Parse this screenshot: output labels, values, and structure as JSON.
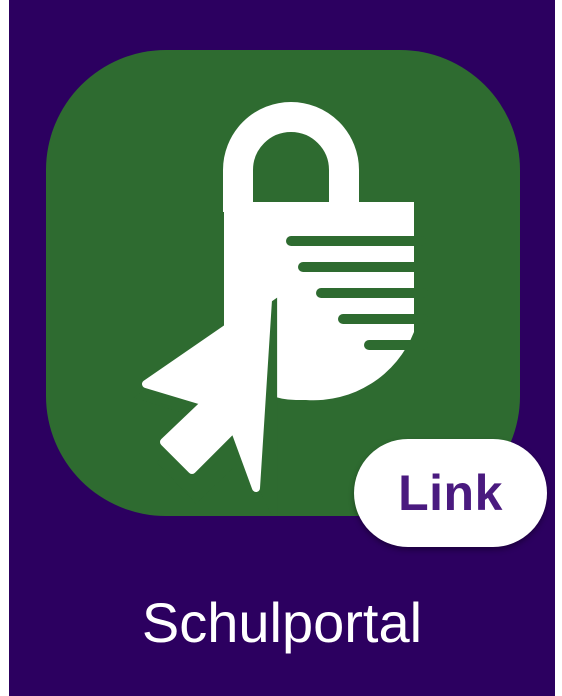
{
  "app": {
    "name": "Schulportal",
    "badge": "Link",
    "icon": "lock-pointer-icon"
  },
  "colors": {
    "background": "#2c0060",
    "tile": "#2e6b30",
    "badge_bg": "#ffffff",
    "badge_text": "#4a1a7f",
    "label_text": "#ffffff"
  }
}
